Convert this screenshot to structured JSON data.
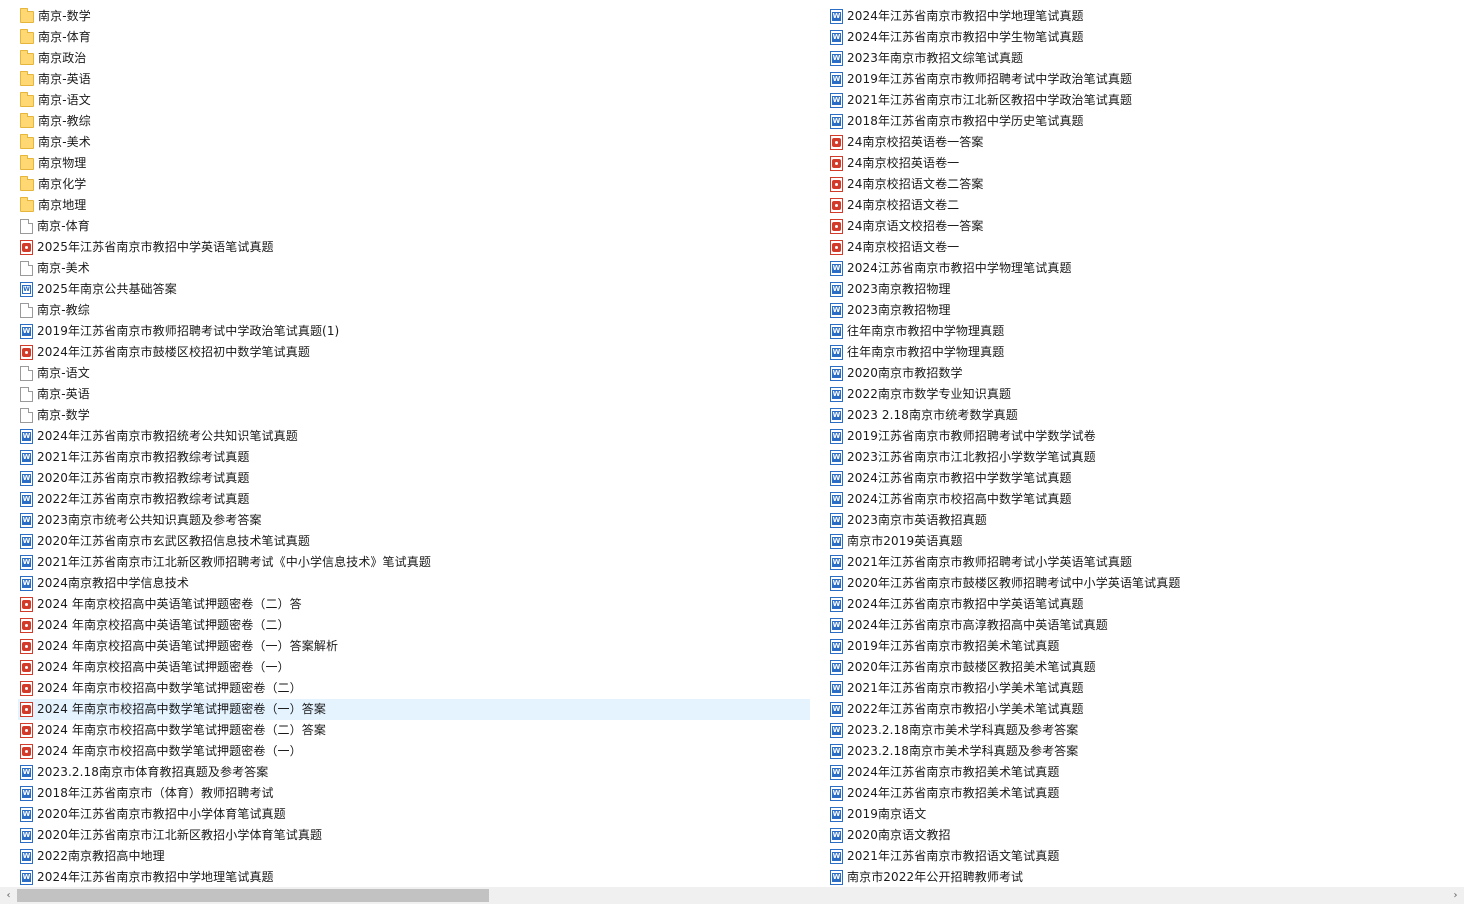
{
  "left_items": [
    {
      "type": "folder",
      "name": "南京-数学"
    },
    {
      "type": "folder",
      "name": "南京-体育"
    },
    {
      "type": "folder",
      "name": "南京政治"
    },
    {
      "type": "folder",
      "name": "南京-英语"
    },
    {
      "type": "folder",
      "name": "南京-语文"
    },
    {
      "type": "folder",
      "name": "南京-教综"
    },
    {
      "type": "folder",
      "name": "南京-美术"
    },
    {
      "type": "folder",
      "name": "南京物理"
    },
    {
      "type": "folder",
      "name": "南京化学"
    },
    {
      "type": "folder",
      "name": "南京地理"
    },
    {
      "type": "blank",
      "name": "南京-体育"
    },
    {
      "type": "pdf",
      "name": "2025年江苏省南京市教招中学英语笔试真题"
    },
    {
      "type": "blank",
      "name": "南京-美术"
    },
    {
      "type": "word-alt",
      "name": "2025年南京公共基础答案"
    },
    {
      "type": "blank",
      "name": "南京-教综"
    },
    {
      "type": "word",
      "name": "2019年江苏省南京市教师招聘考试中学政治笔试真题(1)"
    },
    {
      "type": "pdf",
      "name": "2024年江苏省南京市鼓楼区校招初中数学笔试真题"
    },
    {
      "type": "blank",
      "name": "南京-语文"
    },
    {
      "type": "blank",
      "name": "南京-英语"
    },
    {
      "type": "blank",
      "name": "南京-数学"
    },
    {
      "type": "word",
      "name": "2024年江苏省南京市教招统考公共知识笔试真题"
    },
    {
      "type": "word",
      "name": "2021年江苏省南京市教招教综考试真题"
    },
    {
      "type": "word",
      "name": "2020年江苏省南京市教招教综考试真题"
    },
    {
      "type": "word",
      "name": "2022年江苏省南京市教招教综考试真题"
    },
    {
      "type": "word",
      "name": "2023南京市统考公共知识真题及参考答案"
    },
    {
      "type": "word",
      "name": "2020年江苏省南京市玄武区教招信息技术笔试真题"
    },
    {
      "type": "word",
      "name": "2021年江苏省南京市江北新区教师招聘考试《中小学信息技术》笔试真题"
    },
    {
      "type": "word",
      "name": "2024南京教招中学信息技术"
    },
    {
      "type": "pdf",
      "name": "2024 年南京校招高中英语笔试押题密卷（二）答"
    },
    {
      "type": "pdf",
      "name": "2024 年南京校招高中英语笔试押题密卷（二）"
    },
    {
      "type": "pdf",
      "name": "2024 年南京校招高中英语笔试押题密卷（一）答案解析"
    },
    {
      "type": "pdf",
      "name": "2024 年南京校招高中英语笔试押题密卷（一）"
    },
    {
      "type": "pdf",
      "name": "2024 年南京市校招高中数学笔试押题密卷（二）"
    },
    {
      "type": "pdf",
      "name": "2024 年南京市校招高中数学笔试押题密卷（一）答案",
      "selected": true
    },
    {
      "type": "pdf",
      "name": "2024 年南京市校招高中数学笔试押题密卷（二）答案"
    },
    {
      "type": "pdf",
      "name": "2024 年南京市校招高中数学笔试押题密卷（一）"
    },
    {
      "type": "word",
      "name": "2023.2.18南京市体育教招真题及参考答案"
    },
    {
      "type": "word",
      "name": "2018年江苏省南京市（体育）教师招聘考试"
    },
    {
      "type": "word",
      "name": "2020年江苏省南京市教招中小学体育笔试真题"
    },
    {
      "type": "word",
      "name": "2020年江苏省南京市江北新区教招小学体育笔试真题"
    },
    {
      "type": "word",
      "name": "2022南京教招高中地理"
    },
    {
      "type": "word",
      "name": "2024年江苏省南京市教招中学地理笔试真题"
    }
  ],
  "right_items": [
    {
      "type": "word",
      "name": "2024年江苏省南京市教招中学地理笔试真题"
    },
    {
      "type": "word",
      "name": "2024年江苏省南京市教招中学生物笔试真题"
    },
    {
      "type": "word",
      "name": "2023年南京市教招文综笔试真题"
    },
    {
      "type": "word",
      "name": "2019年江苏省南京市教师招聘考试中学政治笔试真题"
    },
    {
      "type": "word",
      "name": "2021年江苏省南京市江北新区教招中学政治笔试真题"
    },
    {
      "type": "word",
      "name": "2018年江苏省南京市教招中学历史笔试真题"
    },
    {
      "type": "pdf",
      "name": "24南京校招英语卷一答案"
    },
    {
      "type": "pdf",
      "name": "24南京校招英语卷一"
    },
    {
      "type": "pdf",
      "name": "24南京校招语文卷二答案"
    },
    {
      "type": "pdf",
      "name": "24南京校招语文卷二"
    },
    {
      "type": "pdf",
      "name": "24南京语文校招卷一答案"
    },
    {
      "type": "pdf",
      "name": "24南京校招语文卷一"
    },
    {
      "type": "word",
      "name": "2024江苏省南京市教招中学物理笔试真题"
    },
    {
      "type": "word",
      "name": "2023南京教招物理"
    },
    {
      "type": "word",
      "name": "2023南京教招物理"
    },
    {
      "type": "word",
      "name": "往年南京市教招中学物理真题"
    },
    {
      "type": "word",
      "name": "往年南京市教招中学物理真题"
    },
    {
      "type": "word",
      "name": "2020南京市教招数学"
    },
    {
      "type": "word",
      "name": "2022南京市数学专业知识真题"
    },
    {
      "type": "word",
      "name": "2023 2.18南京市统考数学真题"
    },
    {
      "type": "word",
      "name": "2019江苏省南京市教师招聘考试中学数学试卷"
    },
    {
      "type": "word",
      "name": "2023江苏省南京市江北教招小学数学笔试真题"
    },
    {
      "type": "word",
      "name": "2024江苏省南京市教招中学数学笔试真题"
    },
    {
      "type": "word",
      "name": "2024江苏省南京市校招高中数学笔试真题"
    },
    {
      "type": "word",
      "name": "2023南京市英语教招真题"
    },
    {
      "type": "word",
      "name": "南京市2019英语真题"
    },
    {
      "type": "word",
      "name": "2021年江苏省南京市教师招聘考试小学英语笔试真题"
    },
    {
      "type": "word",
      "name": "2020年江苏省南京市鼓楼区教师招聘考试中小学英语笔试真题"
    },
    {
      "type": "word",
      "name": "2024年江苏省南京市教招中学英语笔试真题"
    },
    {
      "type": "word",
      "name": "2024年江苏省南京市高淳教招高中英语笔试真题"
    },
    {
      "type": "word",
      "name": "2019年江苏省南京市教招美术笔试真题"
    },
    {
      "type": "word",
      "name": "2020年江苏省南京市鼓楼区教招美术笔试真题"
    },
    {
      "type": "word",
      "name": "2021年江苏省南京市教招小学美术笔试真题"
    },
    {
      "type": "word",
      "name": "2022年江苏省南京市教招小学美术笔试真题"
    },
    {
      "type": "word",
      "name": "2023.2.18南京市美术学科真题及参考答案"
    },
    {
      "type": "word",
      "name": "2023.2.18南京市美术学科真题及参考答案"
    },
    {
      "type": "word",
      "name": "2024年江苏省南京市教招美术笔试真题"
    },
    {
      "type": "word",
      "name": "2024年江苏省南京市教招美术笔试真题"
    },
    {
      "type": "word",
      "name": "2019南京语文"
    },
    {
      "type": "word",
      "name": "2020南京语文教招"
    },
    {
      "type": "word",
      "name": "2021年江苏省南京市教招语文笔试真题"
    },
    {
      "type": "word",
      "name": "南京市2022年公开招聘教师考试"
    }
  ],
  "scrollbar": {
    "left_arrow": "‹",
    "right_arrow": "›",
    "position_fraction": 0.0,
    "visible_fraction": 0.33
  },
  "colors": {
    "selection": "#e5f3ff",
    "folder": "#ffd873",
    "word": "#2b6cc4",
    "pdf": "#d23a2a"
  }
}
